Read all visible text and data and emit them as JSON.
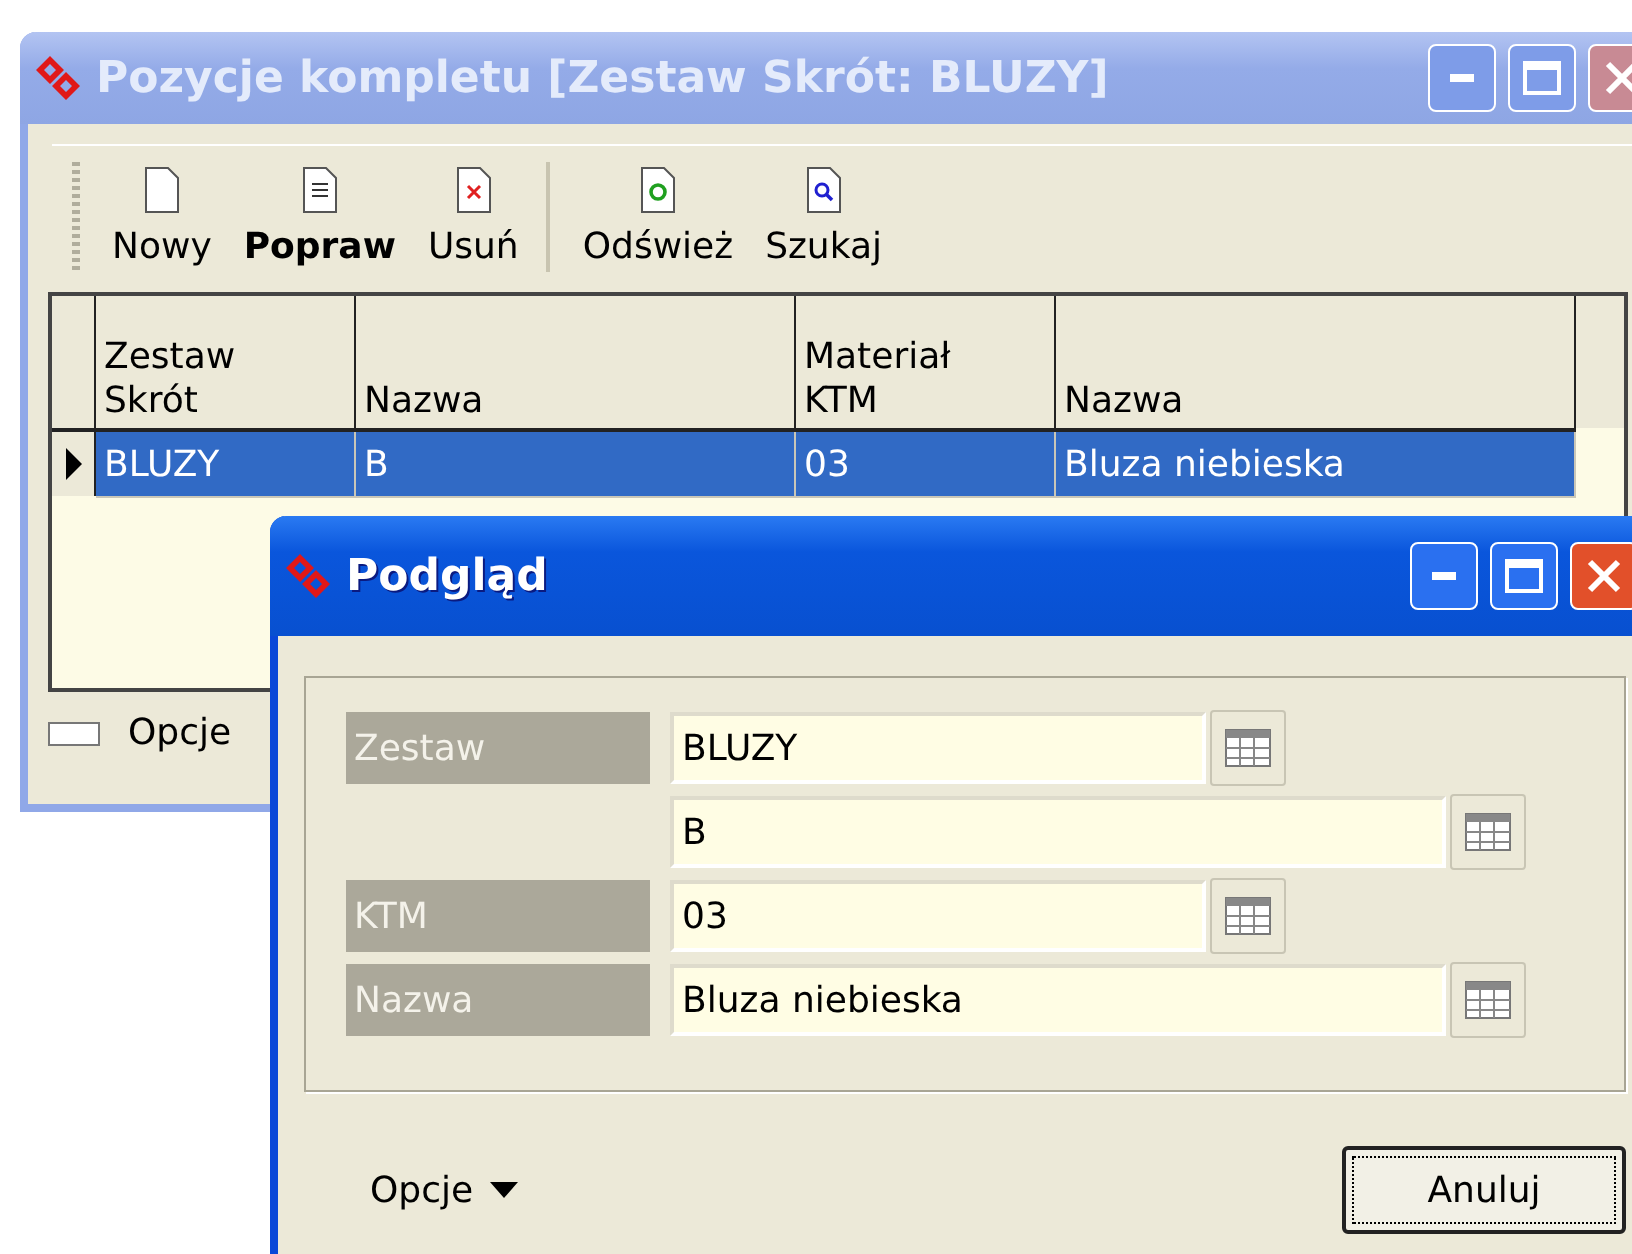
{
  "main_window": {
    "title": "Pozycje kompletu [Zestaw Skrót: BLUZY]",
    "active": false,
    "toolbar_groups": [
      {
        "buttons": [
          {
            "kind": "new",
            "label": "Nowy",
            "bold": false
          },
          {
            "kind": "edit",
            "label": "Popraw",
            "bold": true
          },
          {
            "kind": "delete",
            "label": "Usuń",
            "bold": false
          }
        ]
      },
      {
        "buttons": [
          {
            "kind": "refresh",
            "label": "Odśwież",
            "bold": false
          },
          {
            "kind": "search",
            "label": "Szukaj",
            "bold": false
          }
        ]
      }
    ],
    "table": {
      "columns": [
        "Zestaw\nSkrót",
        "Nazwa",
        "Materiał\nKTM",
        "Nazwa"
      ],
      "rows": [
        {
          "cells": [
            "BLUZY",
            "B",
            "03",
            "Bluza niebieska"
          ],
          "selected": true
        }
      ]
    },
    "footer": {
      "options_label": "Opcje"
    }
  },
  "dialog": {
    "title": "Podgląd",
    "active": true,
    "fields": [
      {
        "label": "Zestaw",
        "value": "BLUZY",
        "kind": "short"
      },
      {
        "value": "B",
        "kind": "long"
      },
      {
        "label": "KTM",
        "value": "03",
        "kind": "short"
      },
      {
        "label": "Nazwa",
        "value": "Bluza niebieska",
        "kind": "long"
      }
    ],
    "options_label": "Opcje",
    "buttons": [
      {
        "label": "Anuluj",
        "focused": true
      }
    ]
  }
}
